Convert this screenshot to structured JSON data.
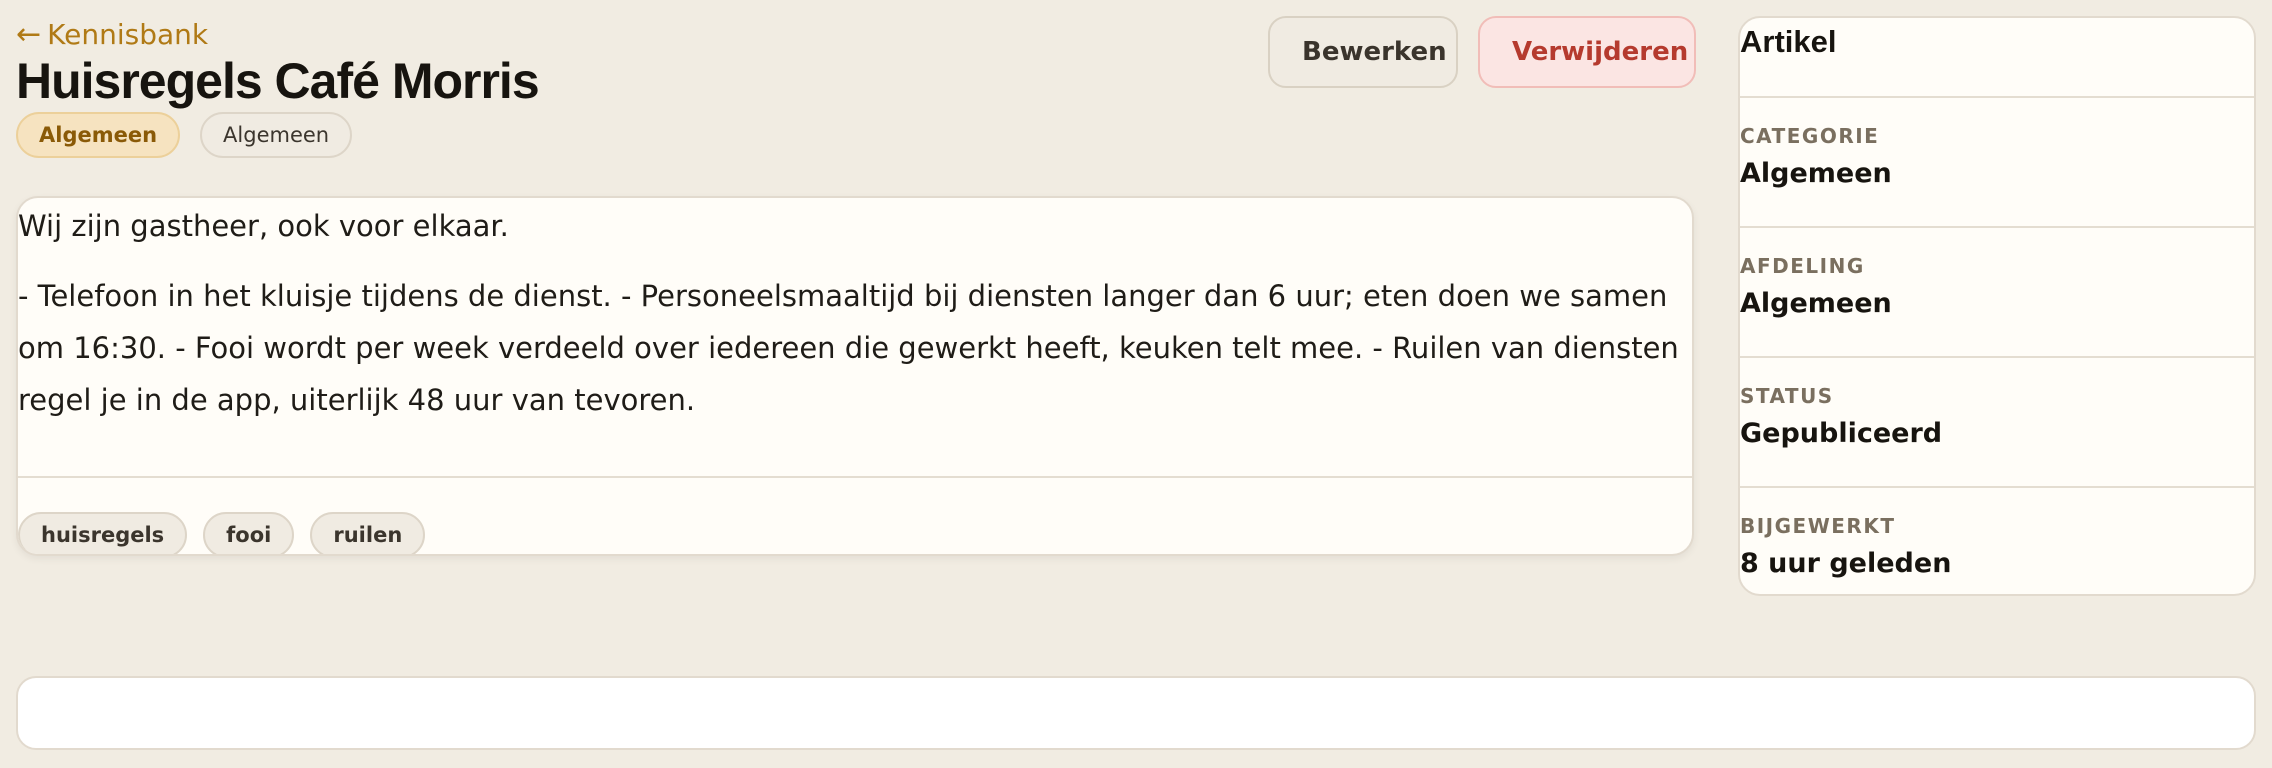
{
  "nav": {
    "back_arrow": "←",
    "back_label": "Kennisbank"
  },
  "article": {
    "title": "Huisregels Café Morris",
    "badges": [
      "Algemeen",
      "Algemeen"
    ],
    "intro": "Wij zijn gastheer, ook voor elkaar.",
    "body": "- Telefoon in het kluisje tijdens de dienst. - Personeelsmaaltijd bij diensten langer dan 6 uur; eten doen we samen om 16:30. - Fooi wordt per week verdeeld over iedereen die gewerkt heeft, keuken telt mee. - Ruilen van diensten regel je in de app, uiterlijk 48 uur van tevoren.",
    "tags": [
      "huisregels",
      "fooi",
      "ruilen"
    ]
  },
  "actions": {
    "edit_label": "Bewerken",
    "delete_label": "Verwijderen"
  },
  "sidebar": {
    "title": "Artikel",
    "rows": [
      {
        "label": "CATEGORIE",
        "value": "Algemeen"
      },
      {
        "label": "AFDELING",
        "value": "Algemeen"
      },
      {
        "label": "STATUS",
        "value": "Gepubliceerd"
      },
      {
        "label": "BIJGEWERKT",
        "value": "8 uur geleden"
      }
    ]
  },
  "colors": {
    "background": "#f1ece2",
    "accent": "#b07a16",
    "danger": "#b53a2e",
    "card": "#fffdf8"
  }
}
